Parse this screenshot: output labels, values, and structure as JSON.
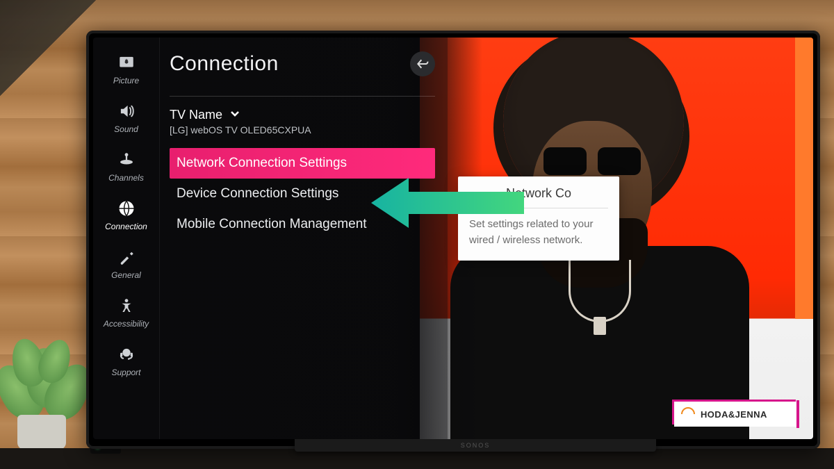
{
  "page_title": "Connection",
  "sidebar": {
    "items": [
      {
        "id": "picture",
        "label": "Picture"
      },
      {
        "id": "sound",
        "label": "Sound"
      },
      {
        "id": "channels",
        "label": "Channels"
      },
      {
        "id": "connection",
        "label": "Connection"
      },
      {
        "id": "general",
        "label": "General"
      },
      {
        "id": "accessibility",
        "label": "Accessibility"
      },
      {
        "id": "support",
        "label": "Support"
      }
    ],
    "active_id": "connection"
  },
  "tv_name": {
    "label": "TV Name",
    "value": "[LG] webOS TV OLED65CXPUA"
  },
  "menu": {
    "items": [
      {
        "id": "network",
        "label": "Network Connection Settings",
        "selected": true
      },
      {
        "id": "device",
        "label": "Device Connection Settings",
        "selected": false
      },
      {
        "id": "mobile",
        "label": "Mobile Connection Management",
        "selected": false
      }
    ]
  },
  "tooltip": {
    "title": "Network Co",
    "body": "Set settings related to your wired / wireless network."
  },
  "broadcast_logo": "HODA&JENNA",
  "soundbar_brand": "SONOS",
  "colors": {
    "accent": "#e81f6e",
    "arrow_start": "#17b3a1",
    "arrow_end": "#43d67e"
  }
}
